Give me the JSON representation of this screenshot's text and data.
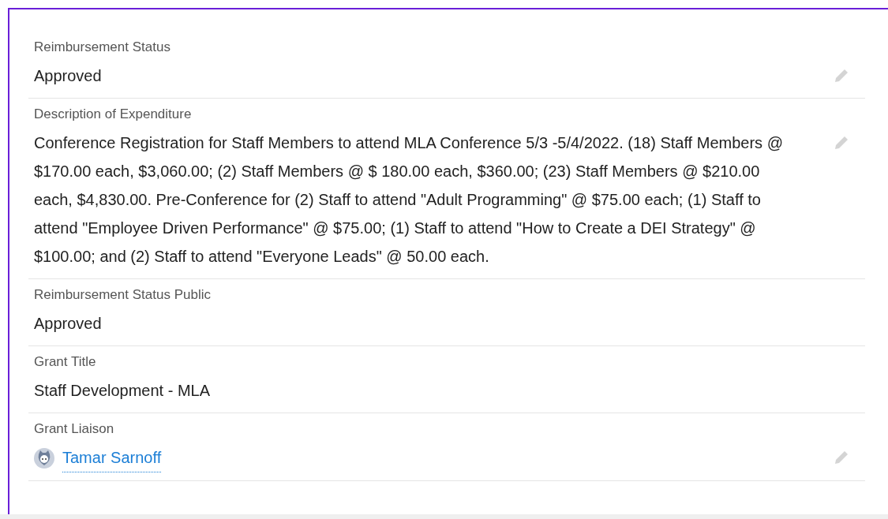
{
  "fields": [
    {
      "label": "Reimbursement Status",
      "value": "Approved",
      "kind": "text",
      "editable": true
    },
    {
      "label": "Description of Expenditure",
      "value": "Conference Registration for Staff Members to attend MLA Conference 5/3 -5/4/2022. (18) Staff Members @ $170.00 each, $3,060.00; (2) Staff Members @ $ 180.00 each, $360.00; (23) Staff Members @ $210.00 each, $4,830.00. Pre-Conference for (2) Staff to attend \"Adult Programming\" @ $75.00 each; (1) Staff to attend \"Employee Driven Performance\" @ $75.00; (1) Staff to attend \"How to Create a DEI Strategy\" @ $100.00; and (2) Staff to attend \"Everyone Leads\" @ 50.00 each.",
      "kind": "text",
      "editable": true
    },
    {
      "label": "Reimbursement Status Public",
      "value": "Approved",
      "kind": "text",
      "editable": false
    },
    {
      "label": "Grant Title",
      "value": "Staff Development - MLA",
      "kind": "text",
      "editable": false
    },
    {
      "label": "Grant Liaison",
      "value": "Tamar Sarnoff",
      "kind": "user",
      "editable": true
    }
  ]
}
